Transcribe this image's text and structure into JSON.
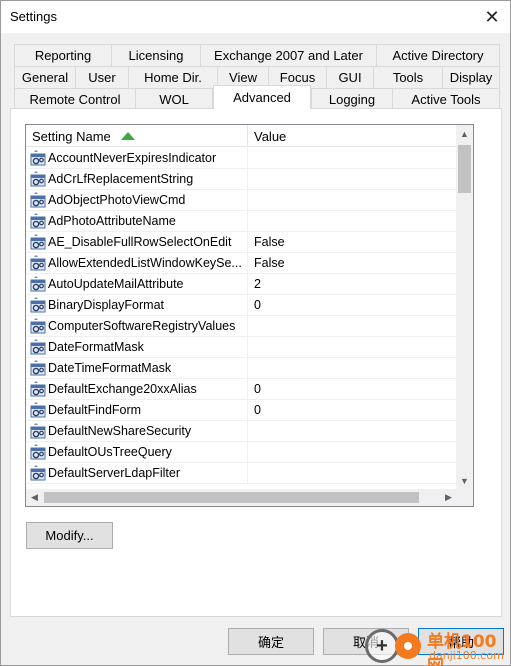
{
  "window": {
    "title": "Settings",
    "close_glyph": "✕"
  },
  "tabs": {
    "row1": [
      "Reporting",
      "Licensing",
      "Exchange 2007 and Later",
      "Active Directory"
    ],
    "row2": [
      "General",
      "User",
      "Home Dir.",
      "View",
      "Focus",
      "GUI",
      "Tools",
      "Display"
    ],
    "row3": [
      "Remote Control",
      "WOL",
      "Advanced",
      "Logging",
      "Active Tools"
    ],
    "active": "Advanced"
  },
  "list": {
    "columns": {
      "name": "Setting Name",
      "value": "Value"
    },
    "sort": {
      "column": "Setting Name",
      "direction": "ascending",
      "indicator_color": "#3da83d"
    },
    "row_icon": "settings-gears-icon",
    "rows": [
      {
        "name": "AccountNeverExpiresIndicator",
        "value": ""
      },
      {
        "name": "AdCrLfReplacementString",
        "value": ""
      },
      {
        "name": "AdObjectPhotoViewCmd",
        "value": ""
      },
      {
        "name": "AdPhotoAttributeName",
        "value": ""
      },
      {
        "name": "AE_DisableFullRowSelectOnEdit",
        "value": "False"
      },
      {
        "name": "AllowExtendedListWindowKeySe...",
        "value": "False"
      },
      {
        "name": "AutoUpdateMailAttribute",
        "value": "2"
      },
      {
        "name": "BinaryDisplayFormat",
        "value": "0"
      },
      {
        "name": "ComputerSoftwareRegistryValues",
        "value": ""
      },
      {
        "name": "DateFormatMask",
        "value": ""
      },
      {
        "name": "DateTimeFormatMask",
        "value": ""
      },
      {
        "name": "DefaultExchange20xxAlias",
        "value": "0"
      },
      {
        "name": "DefaultFindForm",
        "value": "0"
      },
      {
        "name": "DefaultNewShareSecurity",
        "value": ""
      },
      {
        "name": "DefaultOUsTreeQuery",
        "value": ""
      },
      {
        "name": "DefaultServerLdapFilter",
        "value": ""
      }
    ],
    "scroll_glyphs": {
      "up": "▲",
      "down": "▼",
      "left": "◀",
      "right": "▶"
    }
  },
  "buttons": {
    "modify": "Modify...",
    "ok": "确定",
    "cancel": "取消",
    "help": "帮助"
  },
  "watermark": {
    "brand": "单机100网",
    "domain": "danji100.com",
    "accent": "#f47a20",
    "plus": "+"
  }
}
